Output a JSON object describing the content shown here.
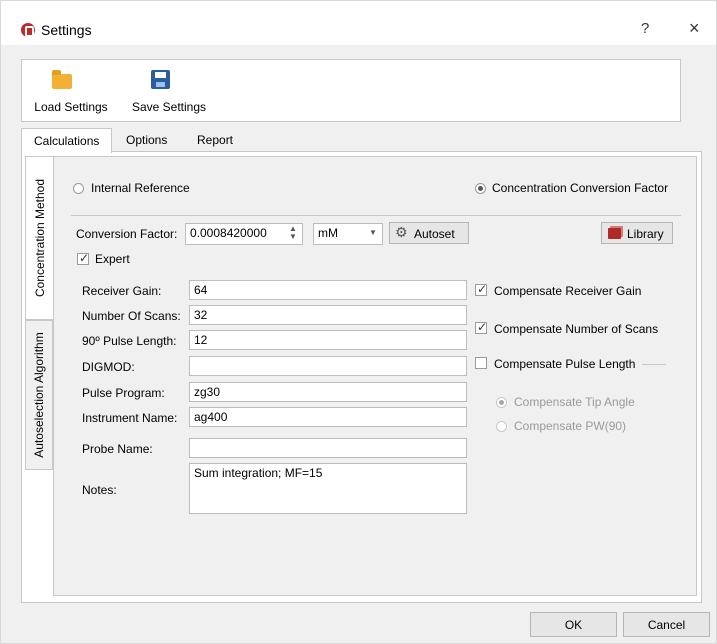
{
  "window": {
    "title": "Settings",
    "help_label": "?",
    "close_label": "×"
  },
  "toolbar": {
    "load_label": "Load Settings",
    "save_label": "Save Settings"
  },
  "tabs": [
    {
      "label": "Calculations",
      "active": true
    },
    {
      "label": "Options",
      "active": false
    },
    {
      "label": "Report",
      "active": false
    }
  ],
  "side_tabs": [
    {
      "label": "Concentration Method",
      "active": true
    },
    {
      "label": "Autoselection Algorithm",
      "active": false
    }
  ],
  "method": {
    "internal_reference_label": "Internal Reference",
    "ccf_label": "Concentration Conversion Factor",
    "selected": "Concentration Conversion Factor"
  },
  "conversion": {
    "label": "Conversion Factor:",
    "value": "0.0008420000",
    "unit": "mM",
    "autoset_label": "Autoset",
    "library_label": "Library"
  },
  "expert": {
    "label": "Expert",
    "checked": true
  },
  "fields": {
    "receiver_gain": {
      "label": "Receiver Gain:",
      "value": "64"
    },
    "number_of_scans": {
      "label": "Number Of Scans:",
      "value": "32"
    },
    "pulse_length": {
      "label": "90º Pulse Length:",
      "value": "12"
    },
    "digmod": {
      "label": "DIGMOD:",
      "value": ""
    },
    "pulse_program": {
      "label": "Pulse Program:",
      "value": "zg30"
    },
    "instrument_name": {
      "label": "Instrument Name:",
      "value": "ag400"
    },
    "probe_name": {
      "label": "Probe Name:",
      "value": ""
    },
    "notes": {
      "label": "Notes:",
      "value": "Sum integration; MF=15"
    }
  },
  "compensate": {
    "receiver_gain": {
      "label": "Compensate Receiver Gain",
      "checked": true
    },
    "number_of_scans": {
      "label": "Compensate Number of Scans",
      "checked": true
    },
    "pulse_length": {
      "label": "Compensate Pulse Length",
      "checked": false
    },
    "tip_angle": {
      "label": "Compensate Tip Angle",
      "selected": true,
      "enabled": false
    },
    "pw90": {
      "label": "Compensate PW(90)",
      "selected": false,
      "enabled": false
    }
  },
  "footer": {
    "ok_label": "OK",
    "cancel_label": "Cancel"
  },
  "colors": {
    "accent_logo": "#c0282e",
    "folder": "#f2b134",
    "save": "#2b5d9c",
    "library": "#b02a2a"
  }
}
